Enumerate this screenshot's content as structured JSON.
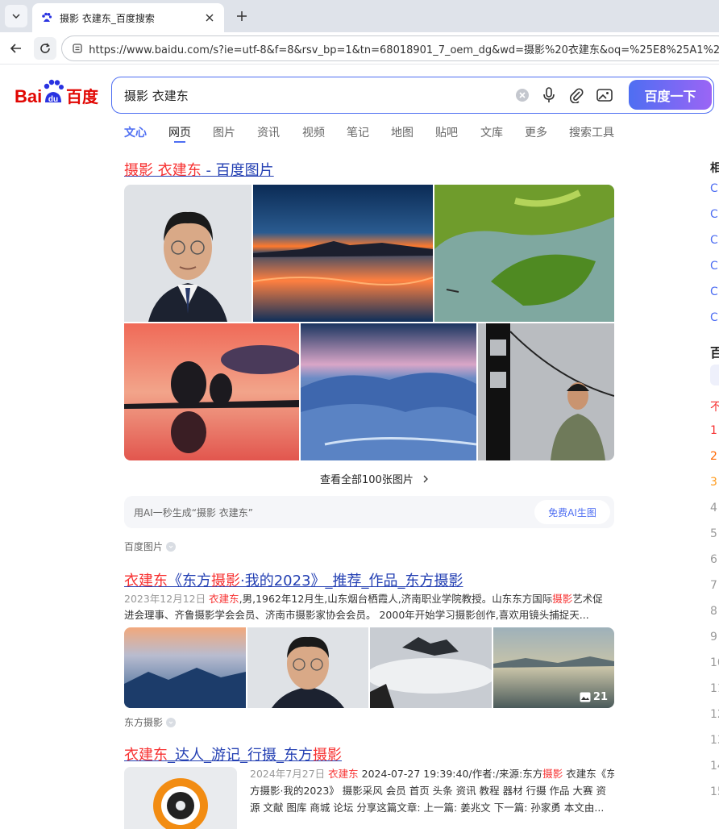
{
  "browser": {
    "tab_title": "摄影 衣建东_百度搜索",
    "url": "https://www.baidu.com/s?ie=utf-8&f=8&rsv_bp=1&tn=68018901_7_oem_dg&wd=摄影%20衣建东&oq=%25E8%25A1%25A3%"
  },
  "search": {
    "query": "摄影 衣建东",
    "button_label": "百度一下"
  },
  "logo": {
    "text_left": "Bai",
    "text_right": "百度",
    "accent": "#2932e1",
    "red": "#e10602"
  },
  "nav_tabs": [
    "文心",
    "网页",
    "图片",
    "资讯",
    "视频",
    "笔记",
    "地图",
    "贴吧",
    "文库",
    "更多",
    "搜索工具"
  ],
  "result1": {
    "title_hl": "摄影 衣建东",
    "title_rest": " - 百度图片",
    "view_all": "查看全部100张图片",
    "ai_prompt": "用AI一秒生成“摄影 衣建东”",
    "ai_button": "免费AI生图",
    "source": "百度图片"
  },
  "result2": {
    "title_parts": [
      "衣建东",
      "《东方",
      "摄影",
      "·我的2023》_推荐_作品_东方摄影"
    ],
    "date": "2023年12月12日",
    "snippet_hl": "衣建东",
    "snippet_line1_a": ",男,1962年12月生,山东烟台栖霞人,济南职业学院教授。山东东方国际",
    "snippet_line1_hl": "摄影",
    "snippet_line1_b": "艺术促",
    "snippet_line2": "进会理事、齐鲁摄影学会会员、济南市摄影家协会会员。 2000年开始学习摄影创作,喜欢用镜头捕捉天...",
    "image_count": "21",
    "source": "东方摄影"
  },
  "result3": {
    "title_hl1": "衣建东",
    "title_mid": "_达人_游记_行摄_东方",
    "title_hl2": "摄影",
    "line1_date": "2024年7月27日",
    "line1_hl": "衣建东",
    "line1_a": " 2024-07-27 19:39:40/作者:/来源:东方",
    "line1_hl2": "摄影",
    "line1_b": " 衣建东《东",
    "line2": "方摄影·我的2023》 摄影采风 会员 首页 头条 资讯 教程 器材 行摄 作品 大赛 资",
    "line3": "源 文献 图库 商城 论坛 分享这篇文章: 上一篇: 姜兆文 下一篇: 孙家勇 本文由..."
  },
  "right_column": {
    "heading": "相",
    "heading2": "百",
    "hot_first": "不",
    "ranks": [
      "1",
      "2",
      "3",
      "4",
      "5",
      "6",
      "7",
      "8",
      "9",
      "10",
      "11",
      "12",
      "13",
      "14",
      "15"
    ]
  }
}
